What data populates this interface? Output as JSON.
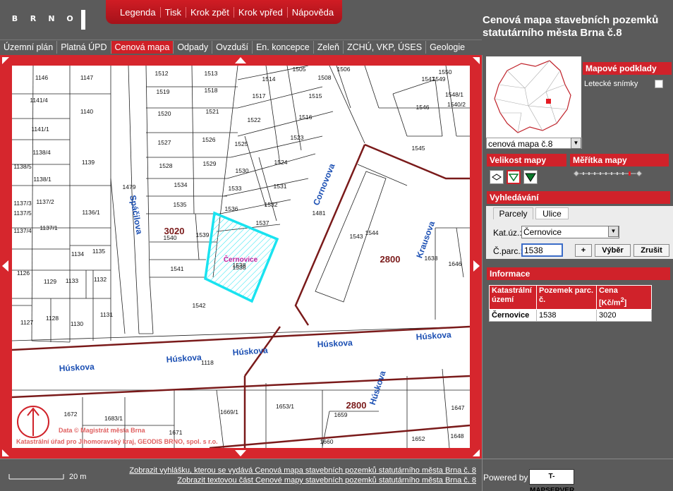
{
  "logo": {
    "letters": [
      "B",
      "R",
      "N",
      "O"
    ]
  },
  "topmenu": [
    "Legenda",
    "Tisk",
    "Krok zpět",
    "Krok vpřed",
    "Nápověda"
  ],
  "title": "Cenová mapa stavebních pozemků statutárního města Brna č.8",
  "tabs": [
    "Územní plán",
    "Platná ÚPD",
    "Cenová mapa",
    "Odpady",
    "Ovzduší",
    "En. koncepce",
    "Zeleň",
    "ZCHÚ, VKP, ÚSES",
    "Geologie"
  ],
  "active_tab": "Cenová mapa",
  "map": {
    "parcels": [
      "1146",
      "1147",
      "1512",
      "1513",
      "1505",
      "1506",
      "1550",
      "1549",
      "1141/4",
      "1519",
      "1518",
      "1514",
      "1508",
      "1547",
      "1548/1",
      "1540/2",
      "1517",
      "1515",
      "1140",
      "1520",
      "1521",
      "1546",
      "1141/1",
      "1522",
      "1516",
      "1527",
      "1526",
      "1525",
      "1523",
      "1545",
      "1138/4",
      "1139",
      "1528",
      "1529",
      "1524",
      "1138/5",
      "1138/1",
      "1530",
      "1479",
      "1534",
      "1533",
      "1531",
      "1137/3",
      "1137/2",
      "1535",
      "1532",
      "1136/1",
      "1137/5",
      "1137/1",
      "1536",
      "1537",
      "1481",
      "1137/4",
      "1540",
      "1539",
      "1543",
      "1544",
      "1134",
      "1135",
      "1538",
      "1638",
      "1646",
      "1126",
      "1541",
      "1129",
      "1133",
      "1132",
      "1542",
      "1131",
      "1128",
      "1127",
      "1130",
      "1118",
      "1653/1",
      "1659",
      "1647",
      "1672",
      "1683/1",
      "1669/1",
      "1671",
      "1660",
      "1648",
      "1652"
    ],
    "price_zones": [
      "3020",
      "2800",
      "2800"
    ],
    "streets": [
      "Spáčilova",
      "Cornovova",
      "Krausova",
      "Húskova",
      "Húskova",
      "Húskova",
      "Húskova",
      "Húskova",
      "Húskova"
    ],
    "selected_label": "Černovice",
    "selected_parcel": "1538",
    "copyright_1": "Data © Magistrát města Brna",
    "copyright_2": "Katastrální úřad pro Jihomoravský kraj, GEODIS BRNO, spol. s r.o."
  },
  "right": {
    "layer_select": "cenová mapa č.8",
    "mapove_podklady": "Mapové podklady",
    "letecke": "Letecké snímky",
    "velikost": "Velikost mapy",
    "meritko": "Měřítka mapy",
    "vyhledavani": "Vyhledávání",
    "tab_parcely": "Parcely",
    "tab_ulice": "Ulice",
    "katuz_label": "Kat.úz.:",
    "katuz_value": "Černovice",
    "cparc_label": "Č.parc.:",
    "cparc_value": "1538",
    "btn_plus": "+",
    "btn_vyber": "Výběr",
    "btn_zrusit": "Zrušit",
    "informace": "Informace",
    "table": {
      "headers": [
        "Katastrální území",
        "Pozemek parc. č.",
        "Cena [Kč/m2]"
      ],
      "rows": [
        [
          "Černovice",
          "1538",
          "3020"
        ]
      ]
    }
  },
  "footer": {
    "scale": "20 m",
    "link1": "Zobrazit vyhlášku, kterou se vydává Cenová mapa stavebních pozemků statutárního města Brna č. 8",
    "link2": "Zobrazit textovou část Cenové mapy stavebních pozemků statutárního města Brna č. 8",
    "powered": "Powered by",
    "tmap": "T-MAPSERVER"
  },
  "colors": {
    "accent": "#d0222a",
    "background": "#5b5b5b",
    "selection": "#19e3f0",
    "zone_line": "#7a1a1a",
    "street_label": "#1b4fb3"
  }
}
